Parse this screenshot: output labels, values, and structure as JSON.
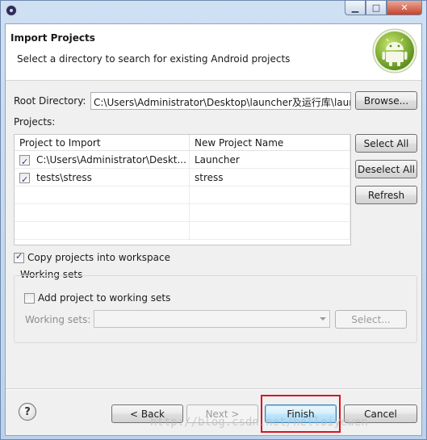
{
  "window": {
    "controls": {
      "minimize": "▁",
      "maximize": "□",
      "close": "✕"
    }
  },
  "header": {
    "title": "Import Projects",
    "description": "Select a directory to search for existing Android projects",
    "logo_icon": "android-icon"
  },
  "root_directory": {
    "label": "Root Directory:",
    "value": "C:\\Users\\Administrator\\Desktop\\launcher及运行库\\laun",
    "browse_label": "Browse..."
  },
  "projects": {
    "label": "Projects:",
    "columns": [
      "Project to Import",
      "New Project Name"
    ],
    "rows": [
      {
        "checked": true,
        "project": "C:\\Users\\Administrator\\Deskt...",
        "name": "Launcher"
      },
      {
        "checked": true,
        "project": "tests\\stress",
        "name": "stress"
      }
    ],
    "select_all_label": "Select All",
    "deselect_all_label": "Deselect All",
    "refresh_label": "Refresh"
  },
  "copy_projects": {
    "label": "Copy projects into workspace",
    "checked": true
  },
  "working_sets": {
    "group_label": "Working sets",
    "add_label": "Add project to working sets",
    "add_checked": false,
    "field_label": "Working sets:",
    "select_label": "Select..."
  },
  "footer": {
    "back_label": "< Back",
    "next_label": "Next >",
    "finish_label": "Finish",
    "cancel_label": "Cancel"
  },
  "watermark": "http://blog.csdn.net/helloiyewen",
  "colors": {
    "highlight": "#d8141f",
    "accent": "#3c7fb1"
  }
}
